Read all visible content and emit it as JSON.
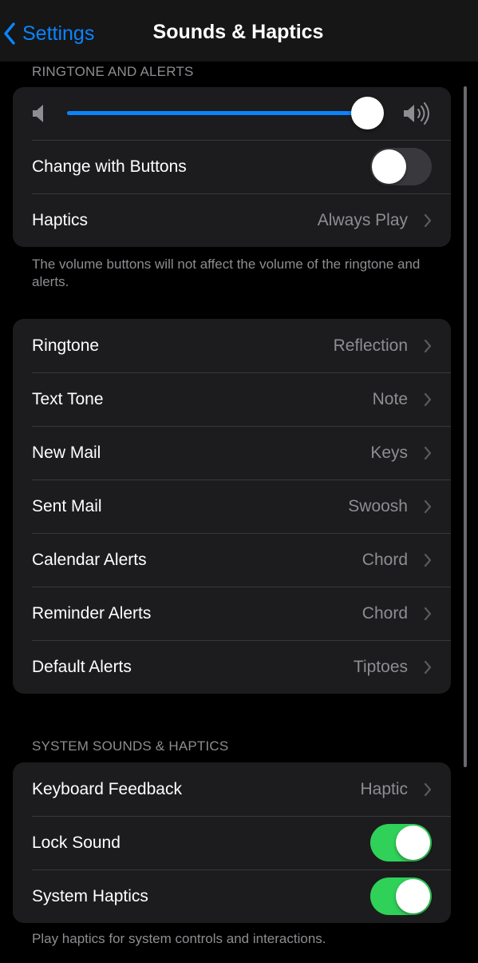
{
  "navbar": {
    "back_label": "Settings",
    "title": "Sounds & Haptics"
  },
  "ringtone_section": {
    "header": "RINGTONE AND ALERTS",
    "volume_level": 0.95,
    "change_with_buttons": {
      "label": "Change with Buttons",
      "on": false
    },
    "haptics": {
      "label": "Haptics",
      "value": "Always Play"
    },
    "footer": "The volume buttons will not affect the volume of the ringtone and alerts."
  },
  "tones": [
    {
      "label": "Ringtone",
      "value": "Reflection"
    },
    {
      "label": "Text Tone",
      "value": "Note"
    },
    {
      "label": "New Mail",
      "value": "Keys"
    },
    {
      "label": "Sent Mail",
      "value": "Swoosh"
    },
    {
      "label": "Calendar Alerts",
      "value": "Chord"
    },
    {
      "label": "Reminder Alerts",
      "value": "Chord"
    },
    {
      "label": "Default Alerts",
      "value": "Tiptoes"
    }
  ],
  "system_section": {
    "header": "SYSTEM SOUNDS & HAPTICS",
    "keyboard_feedback": {
      "label": "Keyboard Feedback",
      "value": "Haptic"
    },
    "lock_sound": {
      "label": "Lock Sound",
      "on": true
    },
    "system_haptics": {
      "label": "System Haptics",
      "on": true
    },
    "footer": "Play haptics for system controls and interactions."
  },
  "colors": {
    "accent": "#0a84ff",
    "toggle_on": "#30d158",
    "toggle_off": "#39393d",
    "cell_background": "#1c1c1e",
    "secondary_text": "#8d8d92"
  },
  "icons": {
    "back": "chevron-left-icon",
    "row_disclosure": "chevron-right-icon",
    "volume_low": "speaker-low-icon",
    "volume_high": "speaker-high-icon"
  }
}
